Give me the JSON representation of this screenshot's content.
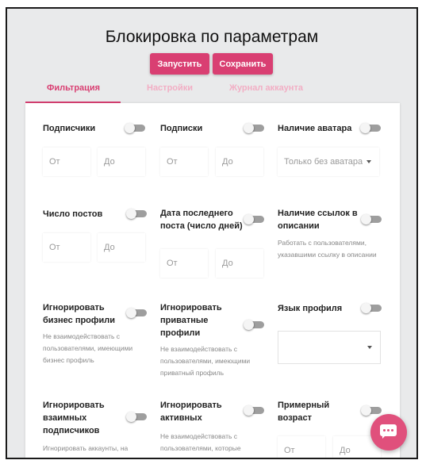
{
  "page": {
    "title": "Блокировка по параметрам",
    "run_label": "Запустить",
    "save_label": "Сохранить"
  },
  "tabs": [
    {
      "label": "Фильтрация",
      "active": true
    },
    {
      "label": "Настройки",
      "active": false
    },
    {
      "label": "Журнал аккаунта",
      "active": false
    }
  ],
  "filters": {
    "followers": {
      "label": "Подписчики",
      "from": "От",
      "to": "До",
      "enabled": false
    },
    "following": {
      "label": "Подписки",
      "from": "От",
      "to": "До",
      "enabled": false
    },
    "avatar": {
      "label": "Наличие аватара",
      "select_value": "Только без аватара",
      "enabled": false
    },
    "posts": {
      "label": "Число постов",
      "from": "От",
      "to": "До",
      "enabled": false
    },
    "last_post": {
      "label": "Дата последнего поста (число дней)",
      "from": "От",
      "to": "До",
      "enabled": false
    },
    "links": {
      "label": "Наличие ссылок в описании",
      "description": "Работать с пользователями, указавшими ссылку в описании",
      "enabled": false
    },
    "ignore_business": {
      "label": "Игнорировать бизнес профили",
      "description": "Не взаимодействовать с пользователями, имеющими бизнес профиль",
      "enabled": false
    },
    "ignore_private": {
      "label": "Игнорировать приватные профили",
      "description": "Не взаимодействовать с пользователями, имеющими приватный профиль",
      "enabled": false
    },
    "language": {
      "label": "Язык профиля",
      "select_value": "",
      "enabled": false
    },
    "ignore_mutual": {
      "label": "Игнорировать взаимных подписчиков",
      "description": "Игнорировать аккаунты, на",
      "enabled": false
    },
    "ignore_active": {
      "label": "Игнорировать активных",
      "description": "Не взаимодействовать с пользователями, которые",
      "enabled": false
    },
    "age": {
      "label": "Примерный возраст",
      "from": "От",
      "to": "До",
      "enabled": false
    }
  },
  "chat": {
    "icon": "chat-icon",
    "color": "#e0507c"
  },
  "colors": {
    "accent": "#d93f72",
    "tab_inactive": "#f2aec4",
    "toggle_off": "#9e9e9e"
  }
}
